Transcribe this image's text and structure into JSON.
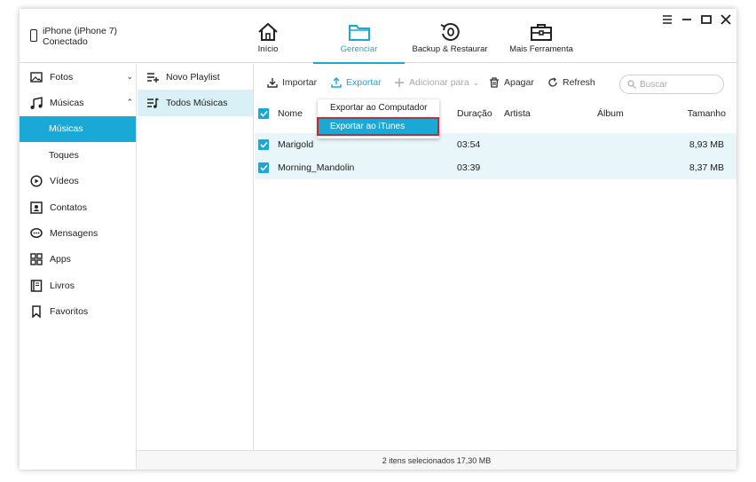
{
  "device": {
    "line1": "iPhone (iPhone 7)",
    "line2": "Conectado"
  },
  "nav": [
    {
      "label": "Início",
      "icon": "home-icon"
    },
    {
      "label": "Gerenciar",
      "icon": "folder-icon",
      "active": true
    },
    {
      "label": "Backup & Restaurar",
      "icon": "backup-restore-icon"
    },
    {
      "label": "Mais Ferramenta",
      "icon": "toolbox-icon"
    }
  ],
  "sidebar": {
    "fotos": "Fotos",
    "musicas": "Músicas",
    "musicas_sub": "Músicas",
    "toques": "Toques",
    "videos": "Vídeos",
    "contatos": "Contatos",
    "mensagens": "Mensagens",
    "apps": "Apps",
    "livros": "Livros",
    "favoritos": "Favoritos"
  },
  "playlists": {
    "new": "Novo Playlist",
    "all": "Todos Músicas"
  },
  "toolbar": {
    "importar": "Importar",
    "exportar": "Exportar",
    "adicionar": "Adicionar para",
    "apagar": "Apagar",
    "refresh": "Refresh",
    "search_placeholder": "Buscar"
  },
  "dropdown": {
    "item1": "Exportar ao Computador",
    "item2": "Exportar ao iTunes"
  },
  "table": {
    "headers": {
      "nome": "Nome",
      "duracao": "Duração",
      "artista": "Artista",
      "album": "Álbum",
      "tamanho": "Tamanho"
    },
    "rows": [
      {
        "nome": "Marigold",
        "duracao": "03:54",
        "artista": "",
        "album": "",
        "tamanho": "8,93 MB"
      },
      {
        "nome": "Morning_Mandolin",
        "duracao": "03:39",
        "artista": "",
        "album": "",
        "tamanho": "8,37 MB"
      }
    ]
  },
  "status": "2 itens selecionados 17,30 MB",
  "colors": {
    "accent": "#1aa8d6",
    "selection_bg": "#e8f5f9",
    "highlight_border": "#c92a2a"
  }
}
